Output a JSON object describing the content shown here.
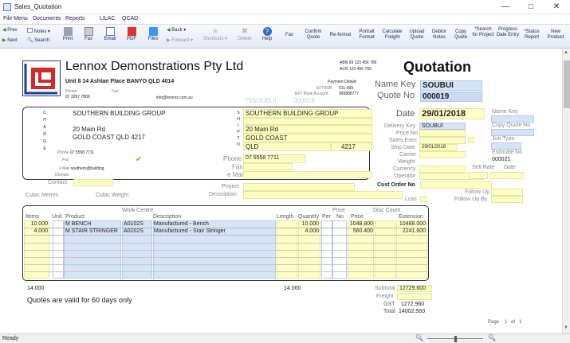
{
  "window": {
    "title": "Sales_Quotation"
  },
  "menu": [
    "File Menu",
    "Documents",
    "Reports",
    "LILAC",
    "QCAD"
  ],
  "toolbar": {
    "prev": "Prev",
    "next": "Next",
    "notes": "Notes",
    "search": "Search",
    "print": "Print",
    "fax": "Fax",
    "email": "Email",
    "pdf": "PDF",
    "files": "Files",
    "back": "Back",
    "forward": "Forward",
    "shortcuts": "Shortcuts",
    "delete": "Delete",
    "help": "Help",
    "right": [
      "Fax",
      "Confirm Quote",
      "Re-format",
      "Portrait Format",
      "Calculate Freight",
      "Upload Quote",
      "Debtor Notes",
      "Copy Quote",
      "*Search for Project",
      "Progress Date Entry",
      "*Status Report",
      "New Product"
    ]
  },
  "company": {
    "name": "Lennox Demonstrations Pty Ltd",
    "address": "Unit 8 14 Ashtan Place BANYO QLD 4014",
    "abn": "ABN 99 123 456 789",
    "acn": "ACN 123 456 789",
    "phone_label": "Phone",
    "phone": "07 3267 7800",
    "fax_label": "Fax",
    "email": "info@lennox.com.au",
    "payment_title": "Payment Details",
    "eftbsb_label": "EFTBSB",
    "eftbsb": "011-999",
    "eftacct_label": "EFT Bank Account",
    "eftacct": "999888777",
    "ghost_code": "75SOUBUI",
    "ghost_no": "000019"
  },
  "doc_title": "Quotation",
  "name_key_label": "Name Key",
  "name_key": "SOUBUI",
  "quote_no_label": "Quote No",
  "quote_no": "000019",
  "charge": {
    "side": [
      "C",
      "H",
      "A",
      "R",
      "G",
      "E"
    ],
    "name": "SOUTHERN BUILDING GROUP",
    "addr1": "20 Main Rd",
    "addr2": "GOLD COAST QLD 4217",
    "phone_label": "Phone",
    "phone": "07 5558 7711",
    "fax_label": "Fax",
    "email_label": "e.Mail",
    "email": "southern@building",
    "domain_label": "Domain",
    "check": "✔"
  },
  "shipto": {
    "side": [
      "S",
      "H",
      "I",
      "P",
      "",
      "T",
      "O"
    ],
    "name": "SOUTHERN BUILDING GROUP",
    "addr1": "20 Main Rd",
    "city": "GOLD COAST",
    "state": "QLD",
    "postcode": "4217",
    "phone_label": "Phone",
    "phone": "07 5558 7711",
    "fax_label": "Fax",
    "email_label": "e Mail"
  },
  "date_label": "Date",
  "date": "29/01/2018",
  "details": {
    "delivery_key_label": "Delivery Key",
    "delivery_key": "SOUBUI",
    "price_no_label": "Price No",
    "sales_exec_label": "Sales Exec",
    "ship_date_label": "Ship Date",
    "ship_date": "29/01/2018",
    "carrier_label": "Carrier",
    "weight_label": "Weight",
    "currency_label": "Currency",
    "operator_label": "Operator"
  },
  "right_col": {
    "name_key_label": "Name Key",
    "copy_quote_label": "Copy Quote No",
    "job_type_label": "Job Type",
    "estimate_label": "Estimate No",
    "estimate": "000021",
    "sell_rate_label": "Sell Rate",
    "date_label": "Date"
  },
  "misc": {
    "contact": "Contact",
    "cubic_metres": "Cubic Metres",
    "cubic_weight": "Cubic Weight",
    "project": "Project",
    "description": "Description",
    "cust_order": "Cust Order No",
    "follow_up": "Follow Up",
    "follow_up_by": "Follow Up By",
    "loss": "Loss"
  },
  "grid": {
    "work_centre": "Work Centre",
    "price_hdr": "Price",
    "disc_count": "Disc Count",
    "headers": [
      "Items",
      "Unit",
      "Product",
      "",
      "Description",
      "Length",
      "Quantity",
      "Per",
      "No",
      "Price",
      "",
      "Extension"
    ],
    "rows": [
      {
        "items": "10.000",
        "product": "M BENCH",
        "code": "A0102S",
        "desc": "Manufactured - Bench",
        "qty": "10.000",
        "price": "1048.800",
        "ext": "10488.000"
      },
      {
        "items": "4.000",
        "product": "M STAIR STRINGER",
        "code": "A0202S",
        "desc": "Manufactured - Stair Stringer",
        "qty": "4.000",
        "price": "560.400",
        "ext": "2241.600"
      }
    ]
  },
  "totals": {
    "items_total": "14.000",
    "qty_total": "14.000",
    "subtotal_label": "Subtotal",
    "subtotal": "12729.600",
    "freight_label": "Freight",
    "gst_label": "GST",
    "gst": "1272.960",
    "total_label": "Total",
    "total": "14002.560"
  },
  "footer_note": "Quotes are valid for 60 days only",
  "page": {
    "label": "Page",
    "current": "1",
    "of": "of",
    "total": "1"
  },
  "status": {
    "text": "Ready"
  }
}
